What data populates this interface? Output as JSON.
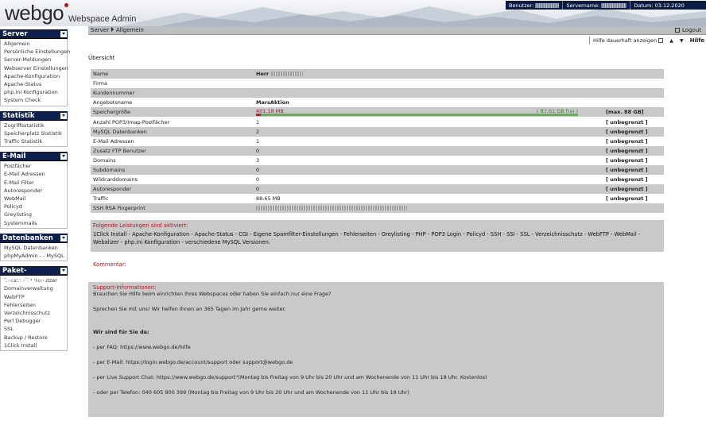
{
  "header": {
    "logo": "webgo",
    "subtitle": "Webspace Admin",
    "user_label": "Benutzer:",
    "server_label": "Servername:",
    "date_label": "Datum: 03.12.2020"
  },
  "sidebar": [
    {
      "title": "Server",
      "items": [
        "Allgemein",
        "Persönliche Einstellungen",
        "Server-Meldungen",
        "Webserver Einstellungen",
        "Apache-Konfiguration",
        "Apache-Status",
        "php.ini Konfiguration",
        "System Check"
      ]
    },
    {
      "title": "Statistik",
      "items": [
        "Zugriffsstatistik",
        "Speicherplatz Statistik",
        "Traffic Statistik"
      ]
    },
    {
      "title": "E-Mail",
      "items": [
        "Postfächer",
        "E-Mail Adressen",
        "E-Mail Filter",
        "Autoresponder",
        "WebMail",
        "Policyd",
        "Greylisting",
        "Systemmails"
      ]
    },
    {
      "title": "Datenbanken",
      "items": [
        "MySQL Datenbanken",
        "phpMyAdmin - - MySQL"
      ]
    },
    {
      "title": "Paket-Verwaltung",
      "items": [
        "Zusatz FTP Benutzer",
        "Domainverwaltung",
        "WebFTP",
        "Fehlerseiten",
        "Verzeichnisschutz",
        "Perl Debugger",
        "SSL",
        "Backup / Restore",
        "1Click Install"
      ]
    }
  ],
  "breadcrumb": {
    "root": "Server",
    "current": "Allgemein"
  },
  "logout_label": "Logout",
  "help": {
    "checkbox_label": "Hilfe dauerhaft anzeigen",
    "up": "▲",
    "down": "▼",
    "help_label": "Hilfe ?"
  },
  "overview_title": "Übersicht",
  "info_rows": [
    {
      "key": "Name",
      "value": "Herr"
    },
    {
      "key": "Firma",
      "value": ""
    },
    {
      "key": "Kundennummer",
      "value": ""
    },
    {
      "key": "Angebotsname",
      "value": "MarsAktion"
    },
    {
      "key": "Speichergröße",
      "used": "401.18 MB",
      "free": "( 87.61 GB frei )",
      "max": "[max. 88 GB]",
      "fraction": 0.0045
    },
    {
      "key": "Anzahl POP3/Imap-Postfächer",
      "value": "1",
      "max": "[ unbegrenzt ]"
    },
    {
      "key": "MySQL Datenbanken",
      "value": "2",
      "max": "[ unbegrenzt ]"
    },
    {
      "key": "E-Mail Adressen",
      "value": "1",
      "max": "[ unbegrenzt ]"
    },
    {
      "key": "Zusatz FTP Benutzer",
      "value": "0",
      "max": "[ unbegrenzt ]"
    },
    {
      "key": "Domains",
      "value": "3",
      "max": "[ unbegrenzt ]"
    },
    {
      "key": "Subdomains",
      "value": "0",
      "max": "[ unbegrenzt ]"
    },
    {
      "key": "Wildcarddomains",
      "value": "0",
      "max": "[ unbegrenzt ]"
    },
    {
      "key": "Autoresponder",
      "value": "0",
      "max": "[ unbegrenzt ]"
    },
    {
      "key": "Traffic",
      "value": "88.65 MB",
      "max": "[ unbegrenzt ]"
    },
    {
      "key": "SSH RSA Fingerprint",
      "value": ""
    }
  ],
  "services": {
    "heading": "Folgende Leistungen sind aktiviert:",
    "text": "1Click Install - Apache-Konfiguration - Apache-Status - CGI - Eigene Spamfilter-Einstellungen - Fehlerseiten - Greylisting - PHP - POP3 Login - Policyd - SSH - SSI - SSL - Verzeichnisschutz - WebFTP - WebMail - Webalizer - php.ini Konfiguration - verschiedene MySQL Versionen."
  },
  "comment_label": "Kommentar:",
  "support": {
    "heading": "Support-Informationen:",
    "line1": "Brauchen Sie Hilfe beim einrichten Ihres Webspaces oder haben Sie einfach nur eine Frage?",
    "line2": "Sprechen Sie mit uns! Wir helfen Ihnen an 365 Tagen im Jahr gerne weiter.",
    "bold": "Wir sind für Sie da:",
    "faq": "- per FAQ: https://www.webgo.de/hilfe",
    "email": "- per E-Mail:  https://login.webgo.de/account/support oder support@webgo.de",
    "chat": "- per Live Support Chat: https://www.webgo.de/support\"(Montag bis Freitag von 9 Uhr bis 20 Uhr und am Wochenende von 11 Uhr bis 18 Uhr. Kostenlos)",
    "phone": "- oder per Telefon: 040 605 900 399 (Montag bis Freitag von 9 Uhr bis 20 Uhr und am Wochenende von 11 Uhr bis 18 Uhr)"
  },
  "colors": {
    "nav": "#0d1f4d",
    "accent": "#b8141b",
    "bar_green": "#5ab748",
    "row_gray": "#c9c9c9"
  }
}
